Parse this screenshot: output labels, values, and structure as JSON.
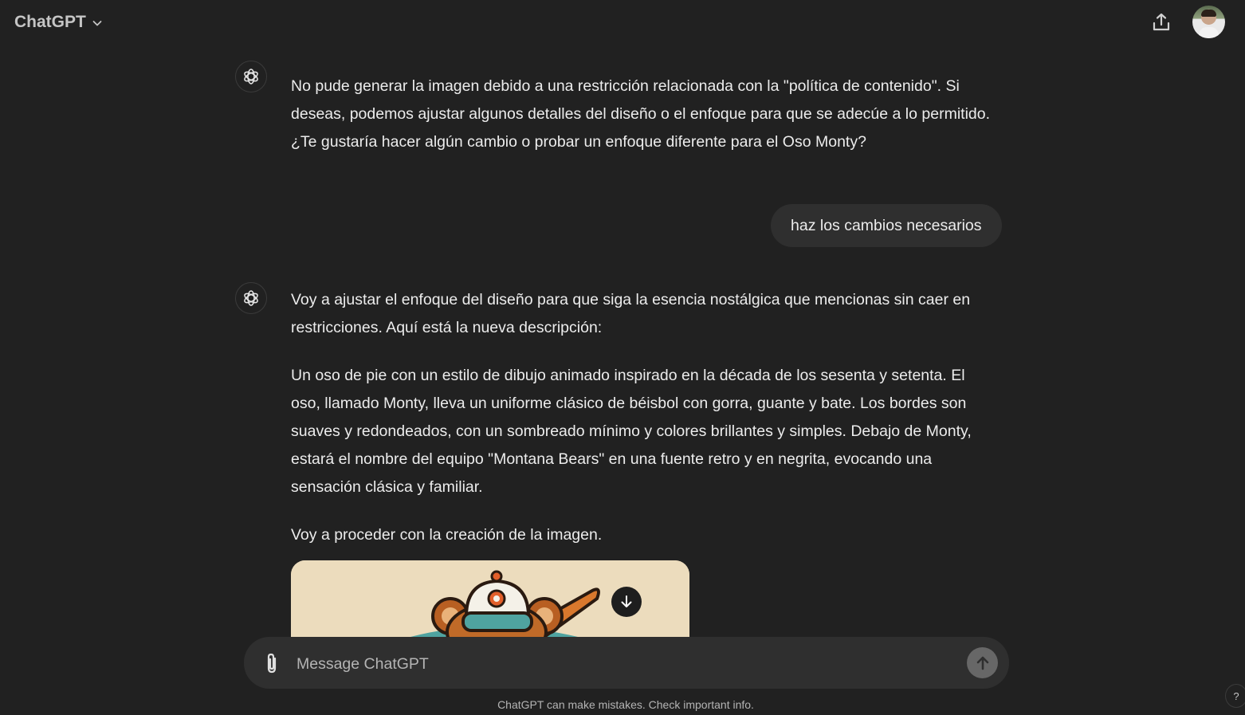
{
  "header": {
    "model_label": "ChatGPT"
  },
  "messages": [
    {
      "role": "assistant",
      "paragraphs": [
        "No pude generar la imagen debido a una restricción relacionada con la \"política de contenido\". Si deseas, podemos ajustar algunos detalles del diseño o el enfoque para que se adecúe a lo permitido. ¿Te gustaría hacer algún cambio o probar un enfoque diferente para el Oso Monty?"
      ]
    },
    {
      "role": "user",
      "text": "haz los cambios necesarios"
    },
    {
      "role": "assistant",
      "paragraphs": [
        "Voy a ajustar el enfoque del diseño para que siga la esencia nostálgica que mencionas sin caer en restricciones. Aquí está la nueva descripción:",
        "Un oso de pie con un estilo de dibujo animado inspirado en la década de los sesenta y setenta. El oso, llamado Monty, lleva un uniforme clásico de béisbol con gorra, guante y bate. Los bordes son suaves y redondeados, con un sombreado mínimo y colores brillantes y simples. Debajo de Monty, estará el nombre del equipo \"Montana Bears\" en una fuente retro y en negrita, evocando una sensación clásica y familiar.",
        "Voy a proceder con la creación de la imagen."
      ]
    }
  ],
  "composer": {
    "placeholder": "Message ChatGPT",
    "value": ""
  },
  "footer": {
    "disclaimer": "ChatGPT can make mistakes. Check important info.",
    "help_label": "?"
  },
  "icons": {
    "model_dropdown": "chevron-down-icon",
    "share": "share-icon",
    "assistant": "openai-logo-icon",
    "download": "arrow-down-icon",
    "attach": "paperclip-icon",
    "send": "arrow-up-icon"
  },
  "colors": {
    "background": "#212121",
    "user_bubble": "#2f2f2f",
    "composer": "#2f2f2f",
    "send_button": "#676767",
    "text": "#ececec"
  }
}
